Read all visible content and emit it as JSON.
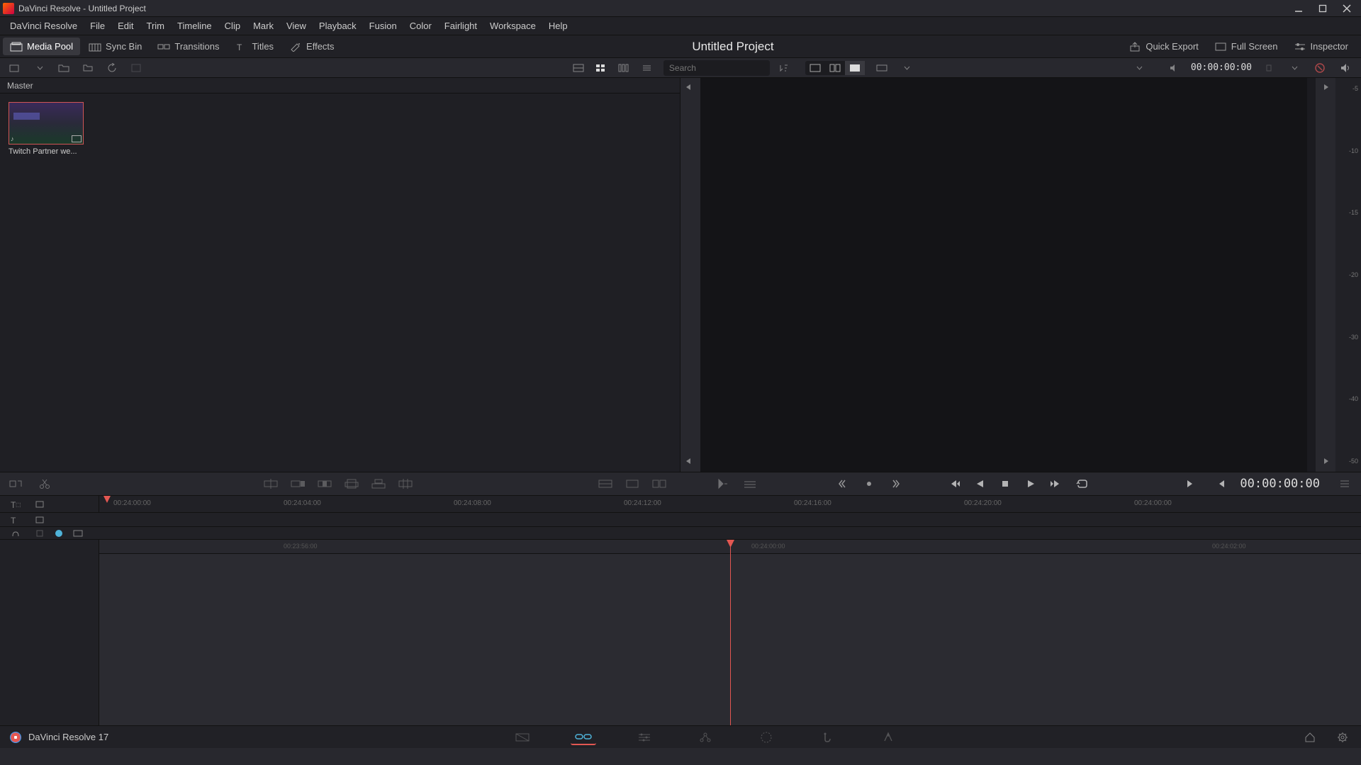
{
  "window": {
    "title": "DaVinci Resolve - Untitled Project"
  },
  "menubar": [
    "DaVinci Resolve",
    "File",
    "Edit",
    "Trim",
    "Timeline",
    "Clip",
    "Mark",
    "View",
    "Playback",
    "Fusion",
    "Color",
    "Fairlight",
    "Workspace",
    "Help"
  ],
  "toolbar": {
    "media_pool": "Media Pool",
    "sync_bin": "Sync Bin",
    "transitions": "Transitions",
    "titles": "Titles",
    "effects": "Effects",
    "project_title": "Untitled Project",
    "quick_export": "Quick Export",
    "full_screen": "Full Screen",
    "inspector": "Inspector"
  },
  "secondbar": {
    "search_placeholder": "Search",
    "timecode": "00:00:00:00"
  },
  "mediapool": {
    "bin_name": "Master",
    "clips": [
      {
        "name": "Twitch Partner we..."
      }
    ]
  },
  "meter_scale": [
    "-5",
    "-10",
    "-15",
    "-20",
    "-30",
    "-40",
    "-50"
  ],
  "editbar": {
    "timecode_right": "00:00:00:00"
  },
  "ruler_tcs": [
    "00:24:00:00",
    "00:24:04:00",
    "00:24:08:00",
    "00:24:12:00",
    "00:24:16:00",
    "00:24:20:00",
    "00:24:00:00"
  ],
  "track_tcs": [
    "00:23:56:00",
    "00:24:00:00",
    "00:24:02:00"
  ],
  "bottombar": {
    "app_name": "DaVinci Resolve 17"
  }
}
